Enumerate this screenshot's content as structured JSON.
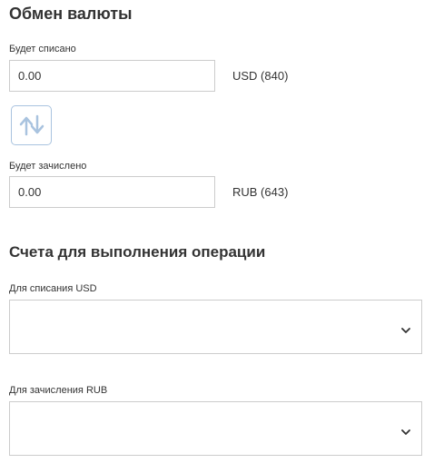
{
  "exchange": {
    "title": "Обмен валюты",
    "debit": {
      "label": "Будет списано",
      "value": "0.00",
      "currency": "USD (840)"
    },
    "credit": {
      "label": "Будет зачислено",
      "value": "0.00",
      "currency": "RUB (643)"
    },
    "swap_icon": "swap-arrows-icon"
  },
  "accounts": {
    "title": "Счета для выполнения операции",
    "debit_account": {
      "label": "Для списания USD",
      "value": ""
    },
    "credit_account": {
      "label": "Для зачисления RUB",
      "value": ""
    },
    "chevron_icon": "chevron-down-icon"
  },
  "colors": {
    "text": "#333333",
    "border": "#cccccc",
    "swap_border": "#a9c3df",
    "swap_arrow": "#a9c3df"
  }
}
